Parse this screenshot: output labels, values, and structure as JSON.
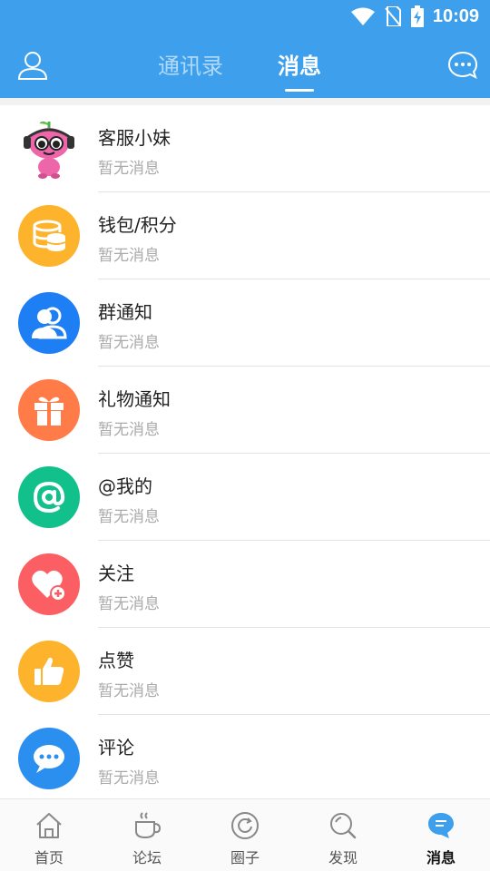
{
  "status_bar": {
    "time": "10:09"
  },
  "header": {
    "tabs": [
      {
        "label": "通讯录",
        "active": false
      },
      {
        "label": "消息",
        "active": true
      }
    ]
  },
  "colors": {
    "header_bg": "#3ea0ec",
    "nav_active": "#3ea0ec"
  },
  "messages": [
    {
      "title": "客服小妹",
      "subtitle": "暂无消息",
      "icon": "mascot-avatar"
    },
    {
      "title": "钱包/积分",
      "subtitle": "暂无消息",
      "icon": "wallet-coins-icon",
      "color": "#fdb32c"
    },
    {
      "title": "群通知",
      "subtitle": "暂无消息",
      "icon": "group-users-icon",
      "color": "#1e7ef3"
    },
    {
      "title": "礼物通知",
      "subtitle": "暂无消息",
      "icon": "gift-icon",
      "color": "#ff7b47"
    },
    {
      "title": "@我的",
      "subtitle": "暂无消息",
      "icon": "at-mention-icon",
      "color": "#11c08a"
    },
    {
      "title": "关注",
      "subtitle": "暂无消息",
      "icon": "heart-plus-icon",
      "color": "#fb5f63"
    },
    {
      "title": "点赞",
      "subtitle": "暂无消息",
      "icon": "thumbs-up-icon",
      "color": "#fdb32c"
    },
    {
      "title": "评论",
      "subtitle": "暂无消息",
      "icon": "comment-bubble-icon",
      "color": "#2b8ff0"
    }
  ],
  "bottom_nav": [
    {
      "label": "首页",
      "icon": "home-icon"
    },
    {
      "label": "论坛",
      "icon": "coffee-cup-icon"
    },
    {
      "label": "圈子",
      "icon": "circle-refresh-icon"
    },
    {
      "label": "发现",
      "icon": "search-icon"
    },
    {
      "label": "消息",
      "icon": "message-icon",
      "active": true
    }
  ]
}
